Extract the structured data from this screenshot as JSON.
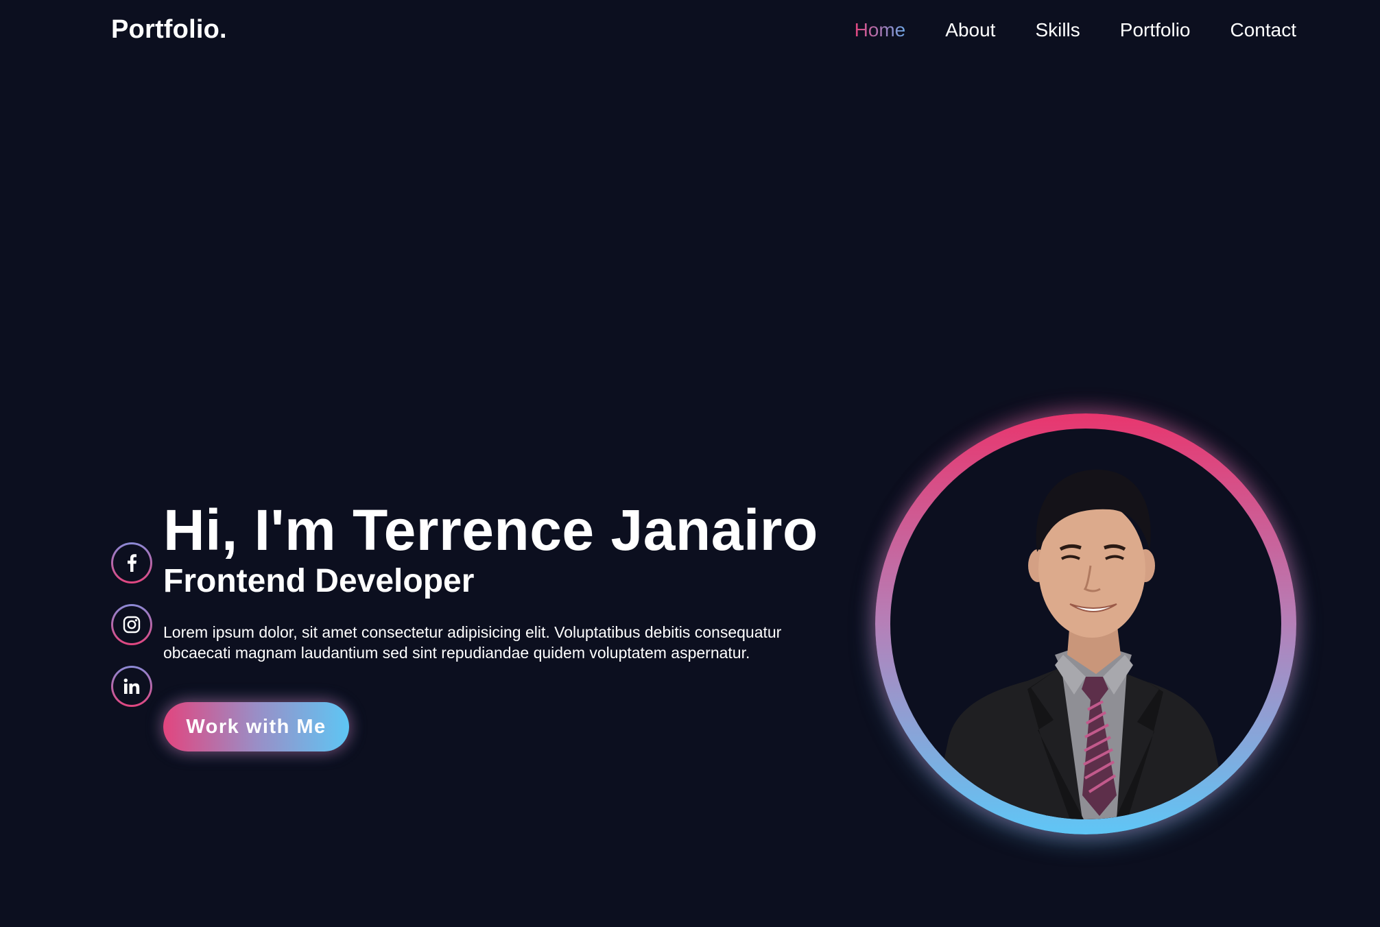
{
  "header": {
    "logo": "Portfolio.",
    "nav": [
      {
        "label": "Home",
        "active": true
      },
      {
        "label": "About",
        "active": false
      },
      {
        "label": "Skills",
        "active": false
      },
      {
        "label": "Portfolio",
        "active": false
      },
      {
        "label": "Contact",
        "active": false
      }
    ]
  },
  "socials": [
    {
      "icon": "facebook-icon"
    },
    {
      "icon": "instagram-icon"
    },
    {
      "icon": "linkedin-icon"
    }
  ],
  "hero": {
    "title": "Hi, I'm Terrence Janairo",
    "subtitle": "Frontend Developer",
    "description": "Lorem ipsum dolor, sit amet consectetur adipisicing elit. Voluptatibus debitis consequatur obcaecati magnam laudantium sed sint repudiandae quidem voluptatem aspernatur.",
    "cta_label": "Work with Me"
  },
  "portrait": {
    "icon": "profile-photo"
  },
  "colors": {
    "background": "#0c0f1f",
    "accent_pink": "#e2457e",
    "accent_blue": "#5ec6f4",
    "text": "#ffffff"
  }
}
